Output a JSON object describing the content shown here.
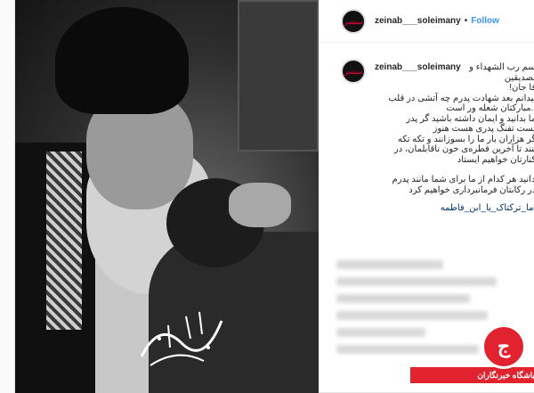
{
  "post": {
    "username": "zeinab___soleimany",
    "follow_label": "Follow",
    "avatar_text": "سنسر"
  },
  "photo": {
    "calligraphy_text": "زینب قاسم"
  },
  "caption": {
    "username": "zeinab___soleimany",
    "lines": [
      "بسم رب الشهداء و",
      "الصدیقین",
      "آقا جان!",
      "میدانم بعد شهادت پدرم چه آتشی در قلب",
      "...مبارکتان شعله ور است",
      "اما بدانید و ایمان داشته باشید گر پدر",
      "نیست تفنگ پدری هست هنوز",
      "اگر هزاران بار ما را بسوزانند و تکه تکه",
      "کنند تا آخرین قطره‌ی خون ناقابلمان، در",
      ".کنارتان خواهیم ایستاد"
    ],
    "lines2": [
      "بدانید هر کدام از ما برای شما مانند پدرم",
      ".در رکابتان فرمانبرداری خواهیم کرد"
    ],
    "hashtag": "#ما_ترکتاک_یا_ابن_فاطمه"
  },
  "watermark": {
    "label": "باشگاه خبرنگاران"
  }
}
